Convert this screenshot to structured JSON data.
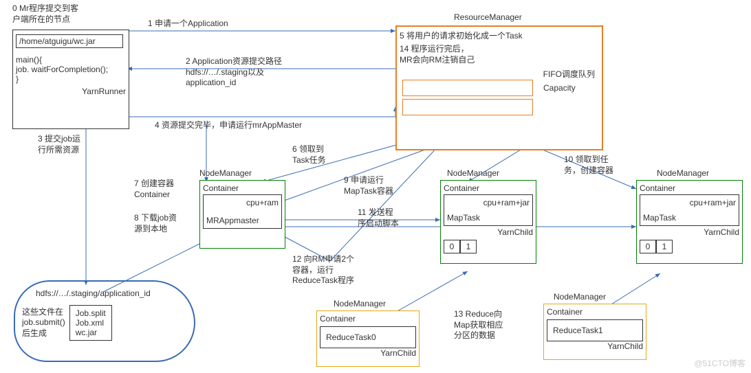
{
  "client": {
    "title": "0 Mr程序提交到客\n户端所在的节点",
    "jar": "/home/atguigu/wc.jar",
    "main_open": "main(){",
    "wait": "  job. waitForCompletion();",
    "main_close": "}",
    "yarnrunner": "YarnRunner"
  },
  "hdfs": {
    "path": "hdfs://…/.staging/application_id",
    "note": "这些文件在\njob.submit()\n后生成",
    "file1": "Job.split",
    "file2": "Job.xml",
    "file3": "wc.jar"
  },
  "rm": {
    "title": "ResourceManager",
    "step5": "5 将用户的请求初始化成一个Task",
    "step14": "14 程序运行完后，\nMR会向RM注销自己",
    "fifo": "FIFO调度队列",
    "capacity": "Capacity"
  },
  "nm1": {
    "title": "NodeManager",
    "container": "Container",
    "cpu": "cpu+ram",
    "app": "MRAppmaster"
  },
  "nm2": {
    "title": "NodeManager",
    "container": "Container",
    "cpu": "cpu+ram+jar",
    "task": "MapTask",
    "child": "YarnChild",
    "p0": "0",
    "p1": "1"
  },
  "nm3": {
    "title": "NodeManager",
    "container": "Container",
    "cpu": "cpu+ram+jar",
    "task": "MapTask",
    "child": "YarnChild",
    "p0": "0",
    "p1": "1"
  },
  "nm4": {
    "title": "NodeManager",
    "container": "Container",
    "task": "ReduceTask0",
    "child": "YarnChild"
  },
  "nm5": {
    "title": "NodeManager",
    "container": "Container",
    "task": "ReduceTask1",
    "child": "YarnChild"
  },
  "steps": {
    "s1": "1 申请一个Application",
    "s2": "2 Application资源提交路径\nhdfs://…/.staging以及\napplication_id",
    "s3": "3 提交job运\n行所需资源",
    "s4": "4 资源提交完毕，申请运行mrAppMaster",
    "s6": "6 领取到\nTask任务",
    "s7": "7 创建容器\nContainer",
    "s8": "8 下载job资\n源到本地",
    "s9": "9 申请运行\nMapTask容器",
    "s10": "10 领取到任\n务，创建容器",
    "s11": "11 发送程\n序启动脚本",
    "s12": "12 向RM申请2个\n容器，运行\nReduceTask程序",
    "s13": "13 Reduce向\nMap获取相应\n分区的数据"
  },
  "watermark": "@51CTO博客"
}
